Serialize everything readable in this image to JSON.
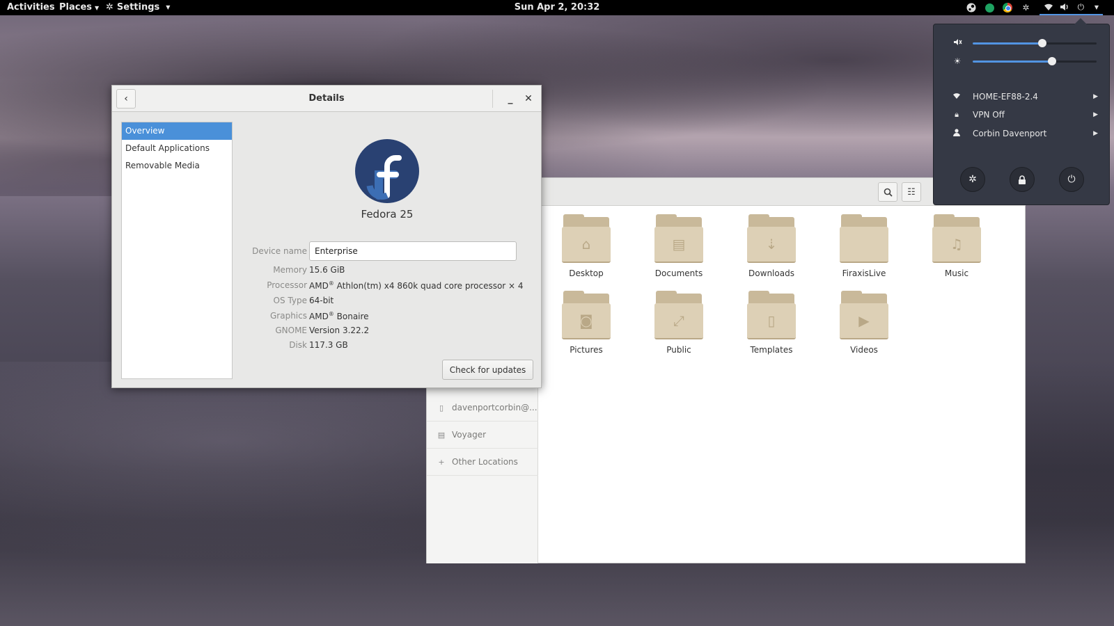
{
  "topbar": {
    "activities": "Activities",
    "places": "Places",
    "settings": "Settings",
    "clock": "Sun Apr  2, 20:32"
  },
  "system_menu": {
    "volume_level": 0.56,
    "brightness_level": 0.64,
    "network": "HOME-EF88-2.4",
    "vpn": "VPN Off",
    "user": "Corbin Davenport",
    "accent": "#5294e2"
  },
  "details": {
    "title": "Details",
    "sidebar": [
      "Overview",
      "Default Applications",
      "Removable Media"
    ],
    "os_name": "Fedora 25",
    "device_name_label": "Device name",
    "device_name": "Enterprise",
    "memory_label": "Memory",
    "memory": "15.6 GiB",
    "processor_label": "Processor",
    "processor_brand": "AMD",
    "processor_model": "Athlon(tm) x4 860k quad core processor × 4",
    "os_type_label": "OS Type",
    "os_type": "64-bit",
    "graphics_label": "Graphics",
    "graphics_brand": "AMD",
    "graphics_model": "Bonaire",
    "gnome_label": "GNOME",
    "gnome": "Version 3.22.2",
    "disk_label": "Disk",
    "disk": "117.3 GB",
    "update_button": "Check for updates",
    "registered_mark": "®",
    "selection_color": "#4a90d9"
  },
  "files": {
    "sidebar": [
      {
        "icon": "drive-icon",
        "label": "davenportcorbin@..."
      },
      {
        "icon": "drive-icon",
        "label": "Voyager"
      },
      {
        "icon": "plus-icon",
        "label": "Other Locations"
      }
    ],
    "folders": [
      "Desktop",
      "Documents",
      "Downloads",
      "FiraxisLive",
      "Music",
      "Pictures",
      "Public",
      "Templates",
      "Videos"
    ],
    "folder_color": "#ddd0b6"
  }
}
